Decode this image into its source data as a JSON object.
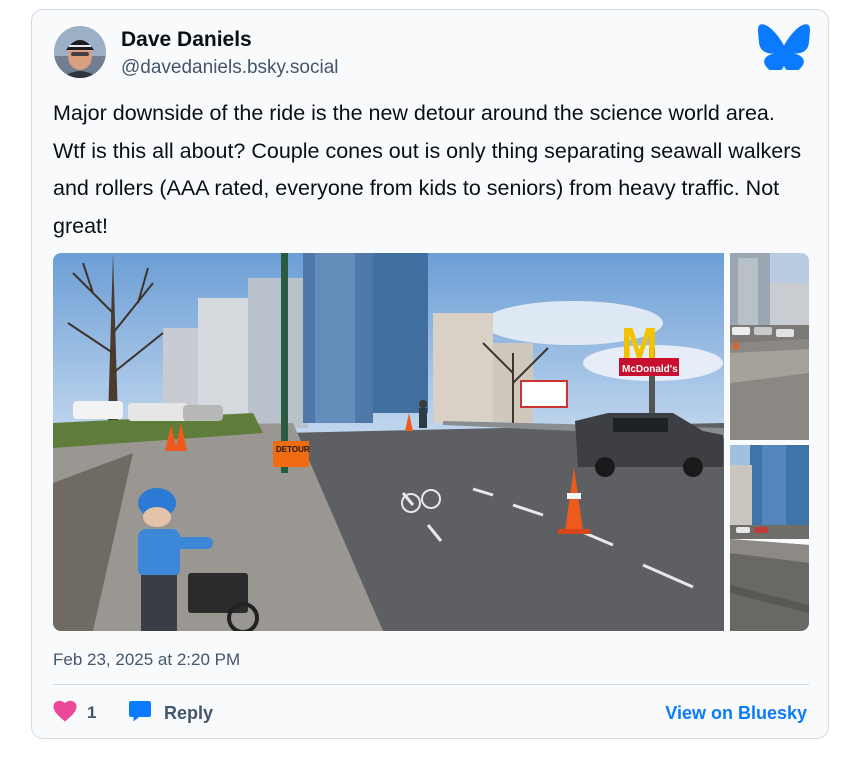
{
  "post": {
    "author": {
      "display_name": "Dave Daniels",
      "handle": "@davedaniels.bsky.social"
    },
    "text": "Major downside of the ride is the new detour around the science world area. Wtf is this all about? Couple cones out is only thing separating seawall walkers and rollers (AAA rated, everyone from kids to seniors) from heavy traffic. Not great!",
    "images": [
      {
        "name": "main-photo",
        "sign_detour": "DETOUR",
        "sign_restaurant": "McDonald's"
      },
      {
        "name": "side-photo-top"
      },
      {
        "name": "side-photo-bottom"
      }
    ],
    "timestamp": "Feb 23, 2025 at 2:20 PM",
    "like_count": "1",
    "reply_label": "Reply",
    "view_label": "View on Bluesky"
  },
  "icons": {
    "brand": "butterfly-icon",
    "like": "heart-icon",
    "reply": "speech-bubble-icon"
  },
  "colors": {
    "brand": "#0a7aff",
    "heart": "#ec4899",
    "text": "#0b0f14",
    "muted": "#42576c",
    "border": "#d4dbe2"
  }
}
